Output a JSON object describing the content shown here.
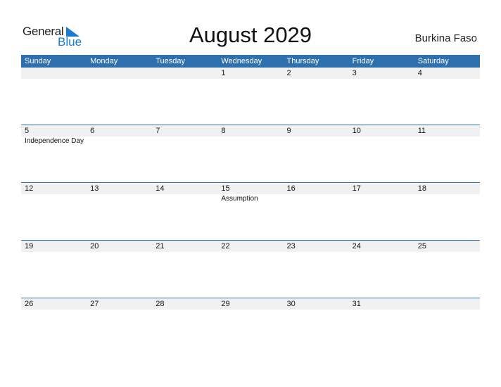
{
  "logo": {
    "line1": "General",
    "line2": "Blue"
  },
  "title": "August 2029",
  "country": "Burkina Faso",
  "colors": {
    "header_bg": "#2e6fae",
    "row_bg": "#f1f1f1",
    "brand_blue": "#1a7bd0"
  },
  "weekdays": [
    "Sunday",
    "Monday",
    "Tuesday",
    "Wednesday",
    "Thursday",
    "Friday",
    "Saturday"
  ],
  "weeks": [
    {
      "days": [
        "",
        "",
        "",
        "1",
        "2",
        "3",
        "4"
      ],
      "events": [
        "",
        "",
        "",
        "",
        "",
        "",
        ""
      ]
    },
    {
      "days": [
        "5",
        "6",
        "7",
        "8",
        "9",
        "10",
        "11"
      ],
      "events": [
        "Independence Day",
        "",
        "",
        "",
        "",
        "",
        ""
      ]
    },
    {
      "days": [
        "12",
        "13",
        "14",
        "15",
        "16",
        "17",
        "18"
      ],
      "events": [
        "",
        "",
        "",
        "Assumption",
        "",
        "",
        ""
      ]
    },
    {
      "days": [
        "19",
        "20",
        "21",
        "22",
        "23",
        "24",
        "25"
      ],
      "events": [
        "",
        "",
        "",
        "",
        "",
        "",
        ""
      ]
    },
    {
      "days": [
        "26",
        "27",
        "28",
        "29",
        "30",
        "31",
        ""
      ],
      "events": [
        "",
        "",
        "",
        "",
        "",
        "",
        ""
      ]
    }
  ]
}
